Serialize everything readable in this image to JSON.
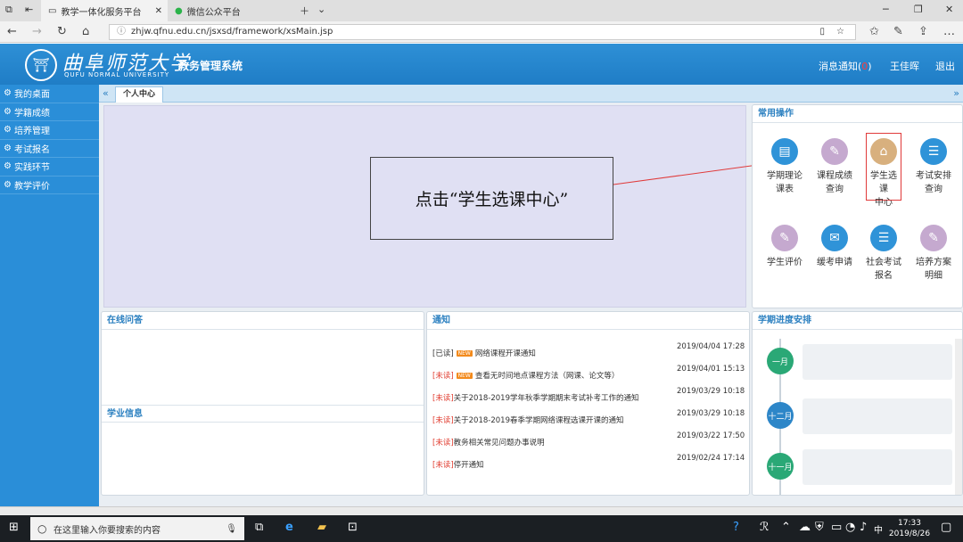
{
  "browser": {
    "tabs": [
      {
        "label": "教学一体化服务平台",
        "active": true
      },
      {
        "label": "微信公众平台",
        "active": false
      }
    ],
    "url": "zhjw.qfnu.edu.cn/jsxsd/framework/xsMain.jsp"
  },
  "header": {
    "logo_text": "曲阜师范大学",
    "logo_sub": "QUFU NORMAL UNIVERSITY",
    "system_name": "教务管理系统",
    "notice_label": "消息通知(",
    "notice_count": "0",
    "notice_close": ")",
    "user_name": "王佳晖",
    "logout_label": "退出",
    "brand_color": "#2a8ed8"
  },
  "sidebar": {
    "items": [
      {
        "label": "我的桌面"
      },
      {
        "label": "学籍成绩"
      },
      {
        "label": "培养管理"
      },
      {
        "label": "考试报名"
      },
      {
        "label": "实践环节"
      },
      {
        "label": "教学评价"
      }
    ]
  },
  "tabstrip": {
    "current_tab": "个人中心"
  },
  "callout": {
    "text": "点击“学生选课中心”"
  },
  "common_ops": {
    "title": "常用操作",
    "items": [
      {
        "label1": "学期理论",
        "label2": "课表",
        "icon": "calendar-icon",
        "color": "#2f93d8"
      },
      {
        "label1": "课程成绩",
        "label2": "查询",
        "icon": "pen-icon",
        "color": "#c5a9cf"
      },
      {
        "label1": "学生选课",
        "label2": "中心",
        "icon": "building-icon",
        "color": "#d8b07e",
        "highlighted": true
      },
      {
        "label1": "考试安排",
        "label2": "查询",
        "icon": "list-icon",
        "color": "#2f93d8"
      },
      {
        "label1": "学生评价",
        "label2": "",
        "icon": "pen-icon",
        "color": "#c5a9cf"
      },
      {
        "label1": "缓考申请",
        "label2": "",
        "icon": "mail-icon",
        "color": "#2f93d8"
      },
      {
        "label1": "社会考试",
        "label2": "报名",
        "icon": "list-icon",
        "color": "#2f93d8"
      },
      {
        "label1": "培养方案",
        "label2": "明细",
        "icon": "pen-icon",
        "color": "#c5a9cf"
      }
    ]
  },
  "qa_panel": {
    "title": "在线问答",
    "info_title": "学业信息"
  },
  "notices": {
    "title": "通知",
    "items": [
      {
        "status": "[已读]",
        "is_new": true,
        "text": "网络课程开课通知",
        "date": "2019/04/04 17:28"
      },
      {
        "status": "[未读]",
        "is_new": true,
        "text": "查看无时间地点课程方法（网课、论文等）",
        "date": "2019/04/01 15:13"
      },
      {
        "status": "[未读]",
        "is_new": false,
        "text": "关于2018-2019学年秋季学期期末考试补考工作的通知",
        "date": "2019/03/29 10:18"
      },
      {
        "status": "[未读]",
        "is_new": false,
        "text": "关于2018-2019春季学期网络课程选课开课的通知",
        "date": "2019/03/29 10:18"
      },
      {
        "status": "[未读]",
        "is_new": false,
        "text": "教务相关常见问题办事说明",
        "date": "2019/03/22 17:50"
      },
      {
        "status": "[未读]",
        "is_new": false,
        "text": "停开通知",
        "date": "2019/02/24 17:14"
      }
    ],
    "new_badge": "NEW"
  },
  "schedule": {
    "title": "学期进度安排",
    "months": [
      {
        "label": "一月",
        "color": "#2aa876"
      },
      {
        "label": "十二月",
        "color": "#2d86c8"
      },
      {
        "label": "十一月",
        "color": "#2aa876"
      }
    ]
  },
  "taskbar": {
    "search_placeholder": "在这里输入你要搜索的内容",
    "time": "17:33",
    "date": "2019/8/26",
    "lang": "中"
  }
}
